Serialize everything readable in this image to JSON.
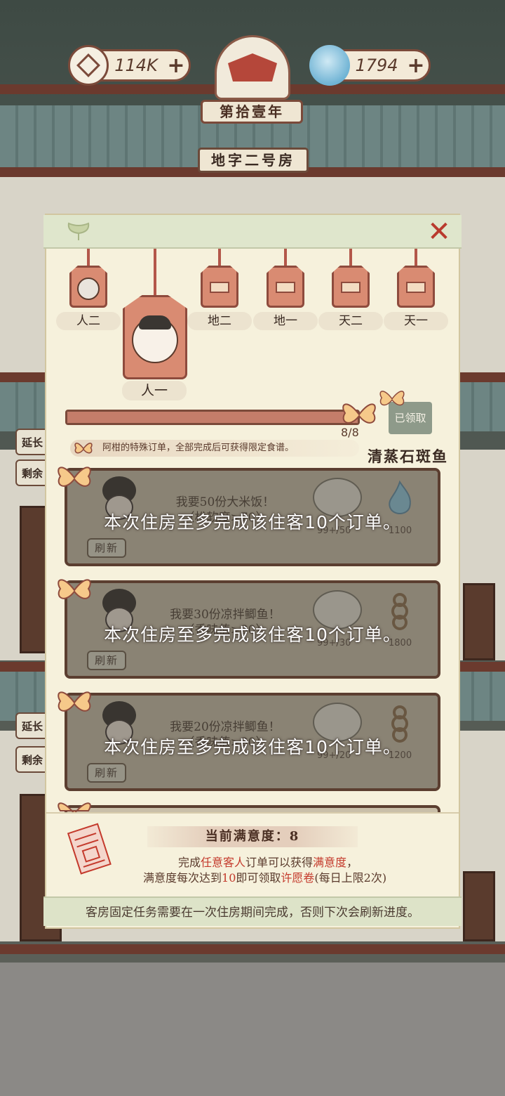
{
  "hud": {
    "coins": "114K",
    "spirit": "1794",
    "plus": "+",
    "year": "第拾壹年",
    "room": "地字二号房"
  },
  "side_signs": [
    "延长",
    "剩余"
  ],
  "dialog": {
    "close": "✕",
    "guests": [
      {
        "label": "人二",
        "locked": false
      },
      {
        "label": "人一",
        "locked": false,
        "selected": true
      },
      {
        "label": "地二",
        "locked": true
      },
      {
        "label": "地一",
        "locked": true
      },
      {
        "label": "天二",
        "locked": true
      },
      {
        "label": "天一",
        "locked": true
      }
    ],
    "progress": {
      "text": "8/8",
      "fraction": 1.0
    },
    "claimed_label": "已领取",
    "special_notice": "阿柑的特殊订单，全部完成后可获得限定食谱。",
    "reward_recipe": "清蒸石斑鱼",
    "orders": [
      {
        "request": "我要50份大米饭！",
        "attr": "（松软度>70）",
        "dish_count": "99+/50",
        "reward": "1100",
        "dish": "rice-bowl",
        "reward_icon": "spirit-icon"
      },
      {
        "request": "我要30份凉拌鲫鱼！",
        "attr": "（香味值>30）",
        "dish_count": "99+/30",
        "reward": "1800",
        "dish": "fish-plate",
        "reward_icon": "coin-string-icon"
      },
      {
        "request": "我要20份凉拌鲫鱼！",
        "attr": "（香味值>30）",
        "dish_count": "99+/20",
        "reward": "1200",
        "dish": "fish-plate",
        "reward_icon": "coin-string-icon"
      }
    ],
    "limit_message": "本次住房至多完成该住客10个订单。",
    "refresh_label": "刷新",
    "satisfaction": {
      "title": "当前满意度：8",
      "line1_a": "完成",
      "line1_b": "任意客人",
      "line1_c": "订单可以获得",
      "line1_d": "满意度",
      "line1_e": "，",
      "line2_a": "满意度每次达到",
      "line2_b": "10",
      "line2_c": "即可领取",
      "line2_d": "许愿卷",
      "line2_e": "(每日上限2次)"
    },
    "footer": "客房固定任务需要在一次住房期间完成，否则下次会刷新进度。"
  },
  "colors": {
    "accent_red": "#c43a2c",
    "tag_fill": "#d98b72",
    "panel_bg": "#f6f1dc",
    "frame_brown": "#5b3e30"
  }
}
